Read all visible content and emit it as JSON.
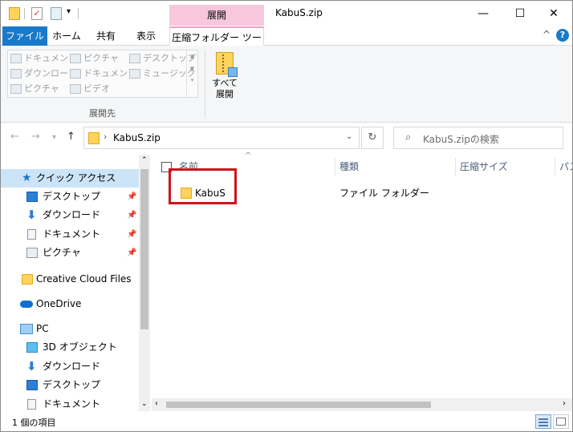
{
  "titlebar": {
    "title": "KabuS.zip",
    "context_tab": "展開",
    "minimize": "—",
    "maximize": "☐",
    "close": "✕"
  },
  "ribbon_tabs": {
    "file": "ファイル",
    "home": "ホーム",
    "share": "共有",
    "view": "表示",
    "compressed_tools": "圧縮フォルダー ツール",
    "collapse": "^",
    "help": "?"
  },
  "ribbon": {
    "gallery": [
      "ドキュメント",
      "ピクチャ",
      "デスクトップ",
      "ダウンロード",
      "ドキュメント",
      "ミュージック",
      "ピクチャ",
      "ビデオ"
    ],
    "group_label": "展開先",
    "extract_all": "すべて\n展開"
  },
  "address": {
    "path": "KabuS.zip",
    "search_placeholder": "KabuS.zipの検索"
  },
  "navpane": {
    "quick_access": "クイック アクセス",
    "qa_items": [
      "デスクトップ",
      "ダウンロード",
      "ドキュメント",
      "ピクチャ"
    ],
    "creative_cloud": "Creative Cloud Files",
    "onedrive": "OneDrive",
    "pc": "PC",
    "pc_items": [
      "3D オブジェクト",
      "ダウンロード",
      "デスクトップ",
      "ドキュメント"
    ]
  },
  "content": {
    "columns": [
      "名前",
      "種類",
      "圧縮サイズ",
      "パス"
    ],
    "rows": [
      {
        "name": "KabuS",
        "type": "ファイル フォルダー"
      }
    ]
  },
  "status": {
    "text": "1 個の項目"
  },
  "colors": {
    "file_tab": "#1979ca",
    "context_pink": "#f7c8dc",
    "highlight_red": "#d0141c",
    "selection": "#cce4f7"
  }
}
